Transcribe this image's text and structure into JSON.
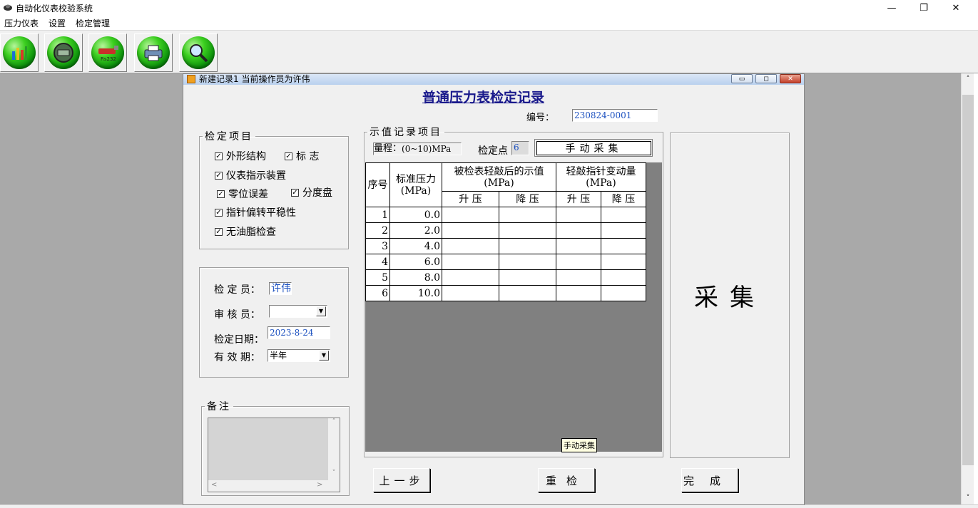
{
  "window": {
    "title": "自动化仪表校验系统",
    "minimize": "—",
    "restore": "❐",
    "close": "✕"
  },
  "menu": [
    "压力仪表",
    "设置",
    "检定管理"
  ],
  "toolbar_icons": [
    "chart-icon",
    "gauge-display-icon",
    "rs232-icon",
    "printer-icon",
    "search-icon"
  ],
  "toolbar_texts": {
    "rs232": "Rs232"
  },
  "child": {
    "caption": "新建记录1    当前操作员为许伟",
    "form_title": "普通压力表检定记录",
    "number_label": "编号：",
    "number_value": "230824-0001"
  },
  "check_items": {
    "legend": "检定项目",
    "items": [
      {
        "label": "外形结构",
        "checked": true
      },
      {
        "label": "标 志",
        "checked": true
      },
      {
        "label": "仪表指示装置",
        "checked": true
      },
      {
        "label": "零位误差",
        "checked": true
      },
      {
        "label": "分度盘",
        "checked": true
      },
      {
        "label": "指针偏转平稳性",
        "checked": true
      },
      {
        "label": "无油脂检查",
        "checked": true
      }
    ],
    "check_mark": "✓"
  },
  "info": {
    "inspector_label": "检 定 员：",
    "inspector_value": "许伟",
    "reviewer_label": "审 核 员：",
    "reviewer_value": "",
    "date_label": "检定日期：",
    "date_value": "2023-8-24",
    "validity_label": "有 效 期：",
    "validity_value": "半年",
    "arrow": "▼"
  },
  "remarks": {
    "legend": "备注",
    "up": "˄",
    "down": "˅",
    "left": "<",
    "right": ">"
  },
  "readings": {
    "legend": "示值记录项目",
    "range_label": "量程：",
    "range_value": "(0~10)MPa",
    "points_label": "检定点",
    "points_value": "6",
    "manual_button": "手动采集",
    "headers": {
      "seq": "序号",
      "std": "标准压力",
      "std_unit": "(MPa)",
      "indicated": "被检表轻敲后的示值",
      "indicated_unit": "(MPa)",
      "change": "轻敲指针变动量",
      "change_unit": "(MPa)",
      "up": "升 压",
      "down": "降 压"
    },
    "rows": [
      {
        "n": "1",
        "std": "0.0"
      },
      {
        "n": "2",
        "std": "2.0"
      },
      {
        "n": "3",
        "std": "4.0"
      },
      {
        "n": "4",
        "std": "6.0"
      },
      {
        "n": "5",
        "std": "8.0"
      },
      {
        "n": "6",
        "std": "10.0"
      }
    ],
    "tooltip": "手动采集"
  },
  "collect_label": "采集",
  "buttons": {
    "prev": "上一步",
    "recheck": "重检",
    "finish": "完成"
  }
}
